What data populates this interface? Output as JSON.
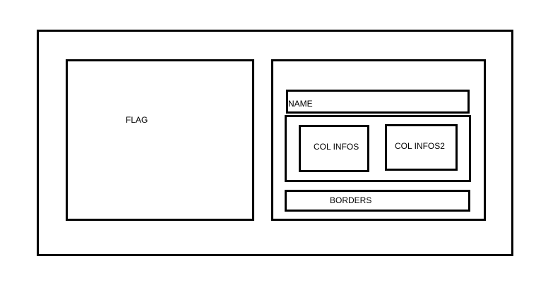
{
  "flag": {
    "label": "FLAG"
  },
  "info": {
    "name": {
      "label": "NAME"
    },
    "columns": [
      {
        "label": "COL INFOS"
      },
      {
        "label": "COL INFOS2"
      }
    ],
    "borders": {
      "label": "BORDERS"
    }
  }
}
